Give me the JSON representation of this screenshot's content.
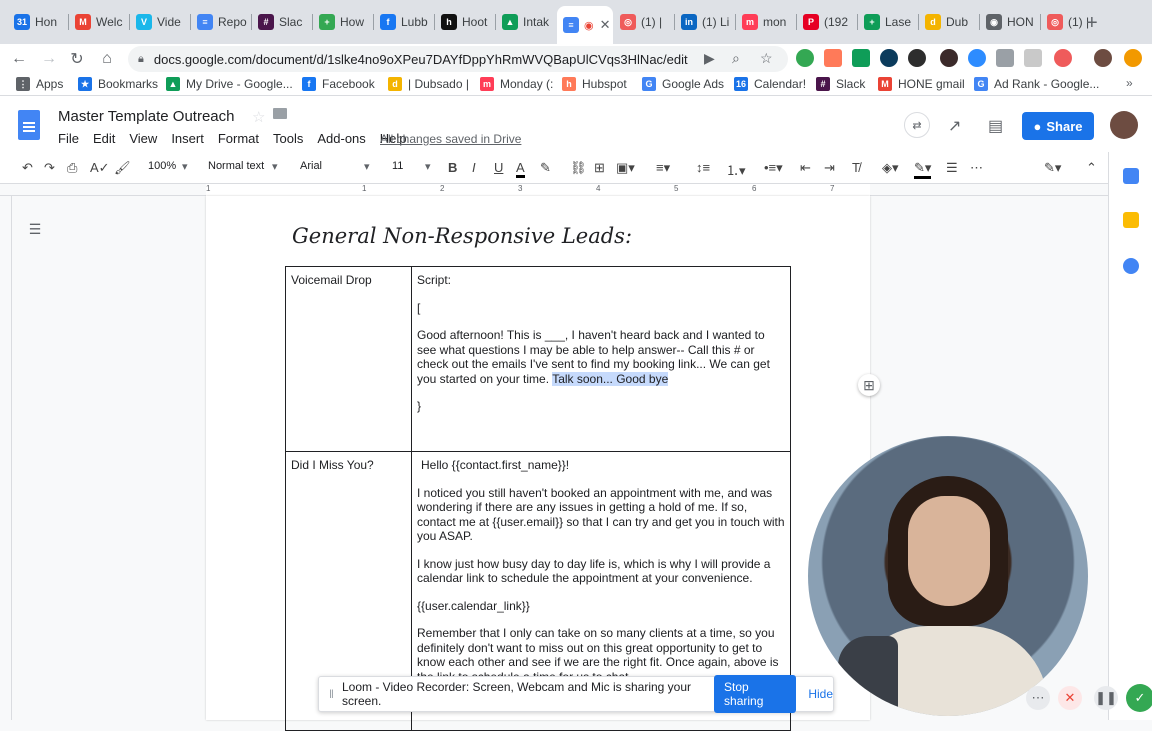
{
  "browser": {
    "tabs": [
      {
        "label": "Hon",
        "color": "#1a73e8",
        "glyph": "31"
      },
      {
        "label": "Welc",
        "color": "#ea4335",
        "glyph": "M"
      },
      {
        "label": "Vide",
        "color": "#1ab7ea",
        "glyph": "V"
      },
      {
        "label": "Repo",
        "color": "#4285f4",
        "glyph": "≡"
      },
      {
        "label": "Slac",
        "color": "#4a154b",
        "glyph": "#"
      },
      {
        "label": "How",
        "color": "#34a853",
        "glyph": "+"
      },
      {
        "label": "Lubb",
        "color": "#1877f2",
        "glyph": "f"
      },
      {
        "label": "Hoot",
        "color": "#111111",
        "glyph": "h"
      },
      {
        "label": "Intak",
        "color": "#0f9d58",
        "glyph": "▲"
      },
      {
        "label": "",
        "color": "#4285f4",
        "glyph": "≡",
        "active": true
      },
      {
        "label": "(1) |",
        "color": "#ef5b5b",
        "glyph": "◎"
      },
      {
        "label": "(1) Li",
        "color": "#0a66c2",
        "glyph": "in"
      },
      {
        "label": "mon",
        "color": "#ff3d57",
        "glyph": "m"
      },
      {
        "label": "(192",
        "color": "#e60023",
        "glyph": "P"
      },
      {
        "label": "Lase",
        "color": "#0f9d58",
        "glyph": "+"
      },
      {
        "label": "Dub",
        "color": "#f4b400",
        "glyph": "d"
      },
      {
        "label": "HON",
        "color": "#5f6368",
        "glyph": "◉"
      },
      {
        "label": "(1) |",
        "color": "#ef5b5b",
        "glyph": "◎"
      }
    ],
    "url": "docs.google.com/document/d/1slke4no9oXPeu7DAYfDppYhRmWVQBapUlCVqs3HlNac/edit",
    "bookmarks": [
      {
        "label": "Apps",
        "color": "#5f6368",
        "glyph": "⋮"
      },
      {
        "label": "Bookmarks",
        "color": "#1a73e8",
        "glyph": "★"
      },
      {
        "label": "My Drive - Google...",
        "color": "#0f9d58",
        "glyph": "▲"
      },
      {
        "label": "Facebook",
        "color": "#1877f2",
        "glyph": "f"
      },
      {
        "label": "| Dubsado |",
        "color": "#f4b400",
        "glyph": "d"
      },
      {
        "label": "Monday (:",
        "color": "#ff3d57",
        "glyph": "m"
      },
      {
        "label": "Hubspot",
        "color": "#ff7a59",
        "glyph": "h"
      },
      {
        "label": "Google Ads",
        "color": "#4285f4",
        "glyph": "G"
      },
      {
        "label": "Calendar!",
        "color": "#1a73e8",
        "glyph": "16"
      },
      {
        "label": "Slack",
        "color": "#4a154b",
        "glyph": "#"
      },
      {
        "label": "HONE gmail",
        "color": "#ea4335",
        "glyph": "M"
      },
      {
        "label": "Ad Rank - Google...",
        "color": "#4285f4",
        "glyph": "G"
      }
    ]
  },
  "doc": {
    "title": "Master Template Outreach",
    "menu": [
      "File",
      "Edit",
      "View",
      "Insert",
      "Format",
      "Tools",
      "Add-ons",
      "Help"
    ],
    "saved_status": "All changes saved in Drive",
    "share_label": "Share",
    "toolbar": {
      "zoom": "100%",
      "style": "Normal text",
      "font": "Arial",
      "size": "11"
    },
    "ruler_numbers": [
      "1",
      "1",
      "2",
      "3",
      "4",
      "5",
      "6",
      "7"
    ],
    "heading": "General Non-Responsive Leads:",
    "table": {
      "row1": {
        "label": "Voicemail Drop",
        "script_label": "Script:",
        "open_bracket": "[",
        "body_start": "Good afternoon! This is ___, I haven't heard back and I wanted to see what questions I may be able to help answer-- Call this # or check out the emails I've sent to find my booking link... We can get you started on your time. ",
        "body_highlight": "Talk soon... Good bye",
        "close_bracket": "}"
      },
      "row2": {
        "label": "Did I Miss You?",
        "p1": "Hello {{contact.first_name}}!",
        "p2": "I noticed you still haven't booked an appointment with me, and was wondering if there are any issues in getting a hold of me. If so, contact me at {{user.email}} so that I can try and get you in touch with you ASAP.",
        "p3": "I know just how busy day to day life is, which is why I will provide a calendar link to schedule the appointment at your convenience.",
        "p4": "{{user.calendar_link}}",
        "p5": "Remember that I only can take on so many clients at a time, so you definitely don't want to miss out on this great opportunity to get to know each other and see if we are the right fit. Once again, above is the link to schedule a time for us to chat..."
      }
    }
  },
  "loom": {
    "message": "Loom - Video Recorder: Screen, Webcam and Mic is sharing your screen.",
    "stop_label": "Stop sharing",
    "hide_label": "Hide"
  }
}
